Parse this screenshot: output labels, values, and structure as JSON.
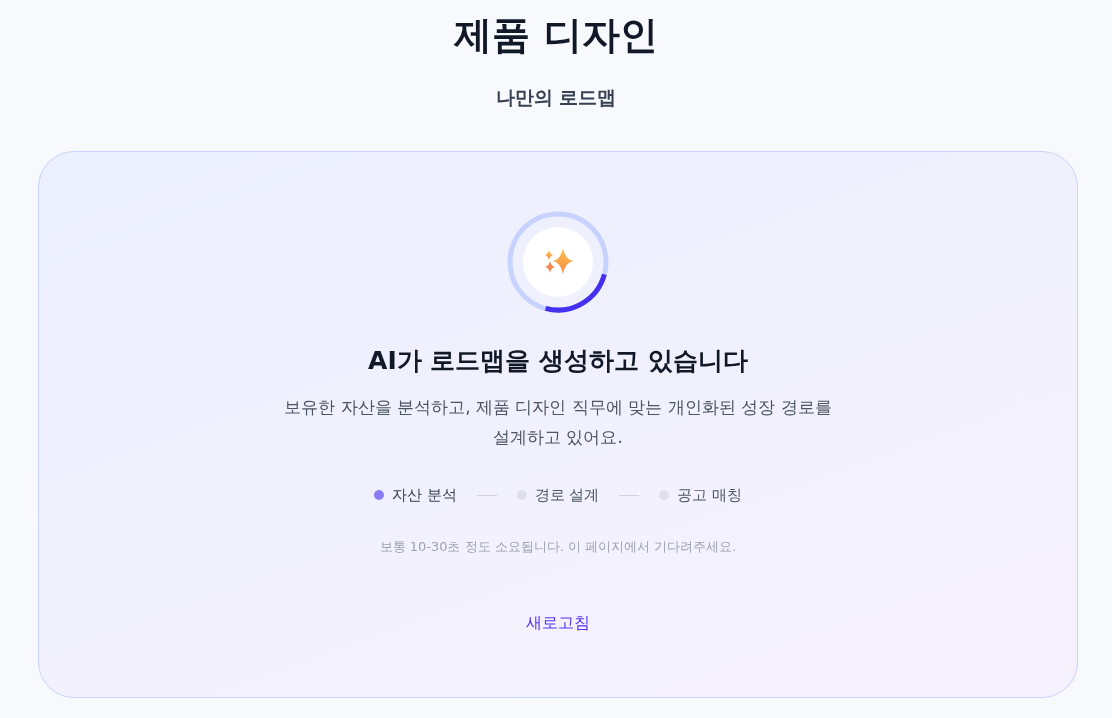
{
  "header": {
    "title": "제품 디자인",
    "subtitle": "나만의 로드맵"
  },
  "status_card": {
    "heading": "AI가 로드맵을 생성하고 있습니다",
    "description": "보유한 자산을 분석하고, 제품 디자인 직무에 맞는 개인화된 성장 경로를 설계하고 있어요.",
    "steps": [
      {
        "label": "자산 분석",
        "active": true
      },
      {
        "label": "경로 설계",
        "active": false
      },
      {
        "label": "공고 매칭",
        "active": false
      }
    ],
    "note": "보통 10-30초 정도 소요됩니다. 이 페이지에서 기다려주세요.",
    "refresh_button": "새로고침"
  }
}
